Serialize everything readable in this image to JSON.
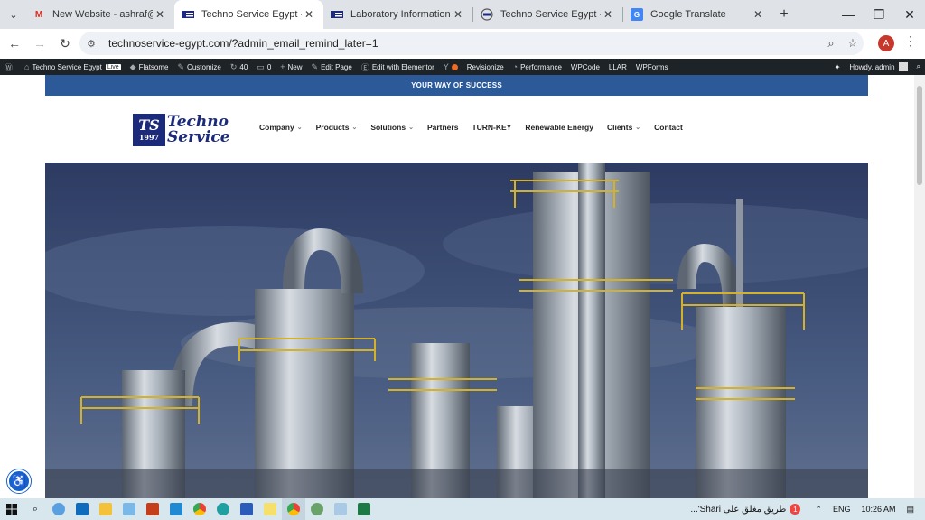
{
  "browser": {
    "tabs": [
      {
        "title": "New Website - ashraf@techn",
        "favicon": "gmail-icon",
        "active": false
      },
      {
        "title": "Techno Service Egypt - Auto",
        "favicon": "ts-icon",
        "active": true
      },
      {
        "title": "Laboratory Information Mar",
        "favicon": "ts-icon",
        "active": false
      },
      {
        "title": "Techno Service Egypt - Auto",
        "favicon": "ts-circle-icon",
        "active": false
      },
      {
        "title": "Google Translate",
        "favicon": "translate-icon",
        "active": false
      }
    ],
    "url": "technoservice-egypt.com/?admin_email_remind_later=1",
    "profile_initial": "A"
  },
  "wp_admin_bar": {
    "site_name": "Techno Service Egypt",
    "live_badge": "Live",
    "flatsome": "Flatsome",
    "customize": "Customize",
    "updates_count": "40",
    "comments_count": "0",
    "new": "New",
    "edit_page": "Edit Page",
    "edit_elementor": "Edit with Elementor",
    "revisionize": "Revisionize",
    "performance": "Performance",
    "wpcode": "WPCode",
    "llar": "LLAR",
    "wpforms": "WPForms",
    "howdy": "Howdy, admin"
  },
  "site": {
    "banner_text": "YOUR WAY OF SUCCESS",
    "logo": {
      "mark": "TS",
      "year": "1997",
      "line1": "Techno",
      "line2": "Service"
    },
    "nav": [
      {
        "label": "Company",
        "dropdown": true
      },
      {
        "label": "Products",
        "dropdown": true
      },
      {
        "label": "Solutions",
        "dropdown": true
      },
      {
        "label": "Partners",
        "dropdown": false
      },
      {
        "label": "TURN-KEY",
        "dropdown": false
      },
      {
        "label": "Renewable Energy",
        "dropdown": false
      },
      {
        "label": "Clients",
        "dropdown": true
      },
      {
        "label": "Contact",
        "dropdown": false
      }
    ]
  },
  "taskbar": {
    "weather_text": "طريق مغلق على Shari'...",
    "weather_badge": "1",
    "language": "ENG",
    "time": "10:26 AM"
  },
  "colors": {
    "banner": "#2c5a99",
    "logo_blue": "#1c2a7b",
    "wp_bar": "#1d2327"
  }
}
